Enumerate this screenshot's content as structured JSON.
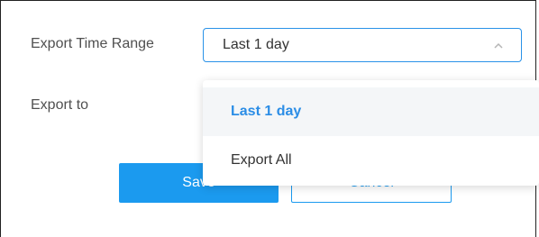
{
  "form": {
    "time_range_label": "Export Time Range",
    "export_to_label": "Export to"
  },
  "select": {
    "value": "Last 1 day",
    "icon": "chevron-up-icon",
    "border_color": "#2a92e8"
  },
  "dropdown": {
    "options": [
      {
        "label": "Last 1 day",
        "selected": true
      },
      {
        "label": "Export All",
        "selected": false
      }
    ],
    "selected_color": "#2b8de6"
  },
  "buttons": {
    "save_label": "Save",
    "cancel_label": "Cancel",
    "primary_color": "#1b9aef"
  }
}
